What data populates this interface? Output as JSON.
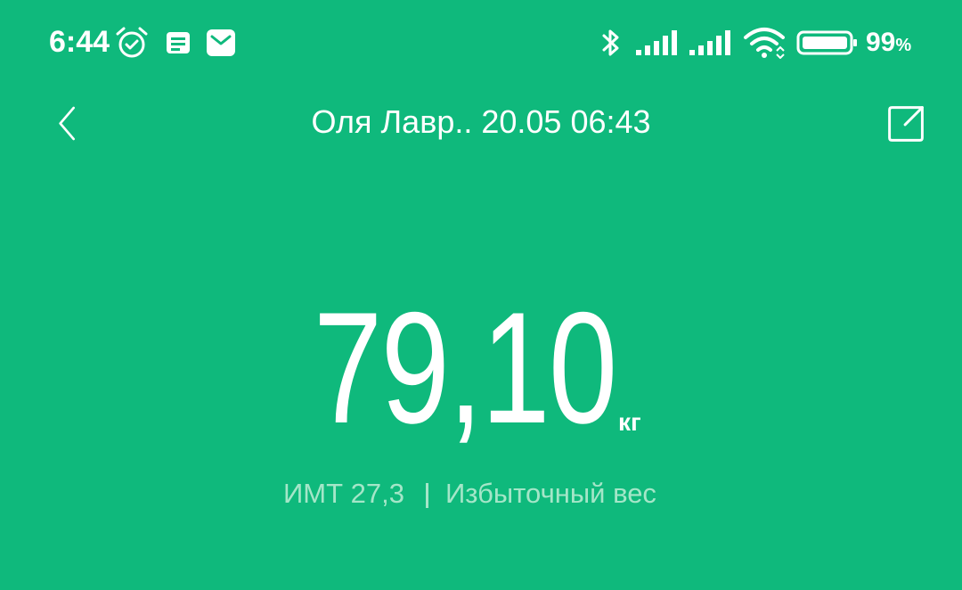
{
  "status_bar": {
    "time": "6:44",
    "battery_percent": "99",
    "battery_percent_symbol": "%",
    "icons": [
      "alarm-icon",
      "notes-notification-icon",
      "mail-notification-icon",
      "bluetooth-icon",
      "signal-strength-icon",
      "signal-strength-icon",
      "wifi-icon",
      "battery-icon"
    ]
  },
  "header": {
    "title": "Оля Лавр.. 20.05 06:43",
    "back_icon": "chevron-left-icon",
    "share_icon": "share-external-icon"
  },
  "measurement": {
    "weight": "79,10",
    "unit": "кг"
  },
  "summary": {
    "bmi_label": "ИМТ 27,3",
    "category": "Избыточный вес"
  },
  "colors": {
    "background": "#0fb97c",
    "primary_text": "#ffffff",
    "secondary_text": "#a4e6c8"
  }
}
